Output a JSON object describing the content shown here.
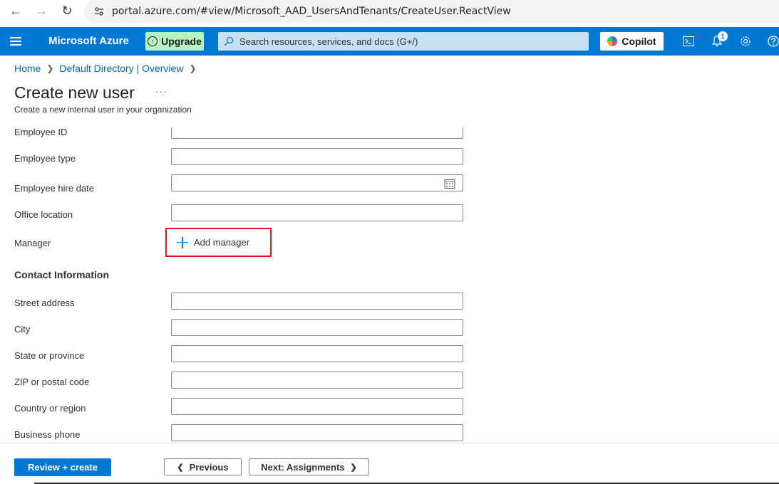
{
  "browser": {
    "url": "portal.azure.com/#view/Microsoft_AAD_UsersAndTenants/CreateUser.ReactView",
    "back_icon": "back-arrow-icon",
    "forward_icon": "forward-arrow-icon",
    "reload_icon": "reload-icon"
  },
  "header": {
    "brand": "Microsoft Azure",
    "upgrade_label": "Upgrade",
    "search_placeholder": "Search resources, services, and docs (G+/)",
    "copilot_label": "Copilot",
    "notification_count": "1",
    "accent_color": "#0078d4"
  },
  "breadcrumb": {
    "items": [
      "Home",
      "Default Directory | Overview"
    ]
  },
  "page": {
    "title": "Create new user",
    "more_label": "···",
    "subtitle": "Create a new internal user in your organization"
  },
  "form": {
    "fields": {
      "employee_id": {
        "label": "Employee ID",
        "value": ""
      },
      "employee_type": {
        "label": "Employee type",
        "value": ""
      },
      "hire_date": {
        "label": "Employee hire date",
        "value": ""
      },
      "office_location": {
        "label": "Office location",
        "value": ""
      },
      "manager": {
        "label": "Manager",
        "action": "Add manager"
      },
      "street": {
        "label": "Street address",
        "value": ""
      },
      "city": {
        "label": "City",
        "value": ""
      },
      "state": {
        "label": "State or province",
        "value": ""
      },
      "zip": {
        "label": "ZIP or postal code",
        "value": ""
      },
      "country": {
        "label": "Country or region",
        "value": ""
      },
      "business_phone": {
        "label": "Business phone",
        "value": ""
      }
    },
    "contact_heading": "Contact Information"
  },
  "footer": {
    "review_label": "Review + create",
    "previous_label": "Previous",
    "next_label": "Next: Assignments"
  }
}
